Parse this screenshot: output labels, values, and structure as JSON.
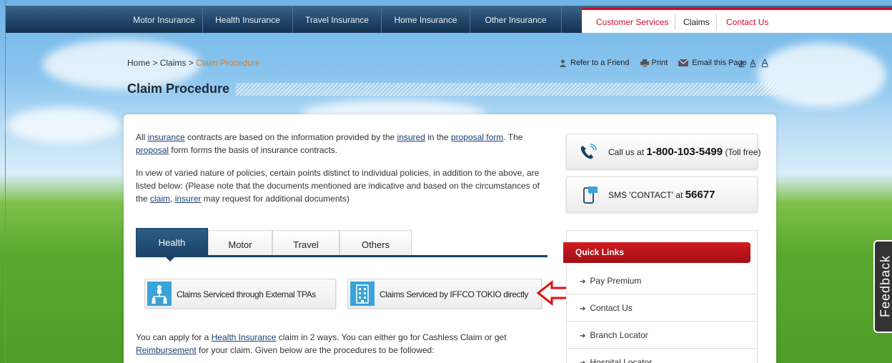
{
  "topnav": {
    "items": [
      "Motor Insurance",
      "Health Insurance",
      "Travel Insurance",
      "Home Insurance",
      "Other Insurance"
    ],
    "customer_services": "Customer Services",
    "claims": "Claims",
    "contact_us": "Contact Us"
  },
  "breadcrumb": {
    "home": "Home",
    "sep": " > ",
    "claims": "Claims",
    "current": "Claim Procedure"
  },
  "page_title": "Claim Procedure",
  "tools": {
    "refer": "Refer to a Friend",
    "print": "Print",
    "email": "Email this Page",
    "font_sizes": [
      "A",
      "A",
      "A"
    ]
  },
  "intro": {
    "p1": {
      "all": "All ",
      "insurance": "insurance",
      "t1": " contracts are based on the information provided by the ",
      "insured": "insured",
      "t2": " in the ",
      "proposal_form": "proposal form",
      "t3": ". The ",
      "proposal": "proposal",
      "t4": " form forms the basis of insurance contracts."
    },
    "p2": {
      "t1": "In view of varied nature of policies, certain points distinct to individual policies, in addition to the above, are listed below: (Please note that the documents mentioned are indicative and based on the circumstances of the ",
      "claim": "claim",
      "t2": ", ",
      "insurer": "insurer",
      "t3": " may request for additional documents)"
    }
  },
  "tabs": [
    "Health",
    "Motor",
    "Travel",
    "Others"
  ],
  "claim_options": {
    "tpa": "Claims Serviced through External TPAs",
    "direct": "Claims Serviced by IFFCO TOKIO directly"
  },
  "bottom_text": {
    "t1": "You can apply for a ",
    "health_insurance": "Health Insurance",
    "t2": " claim in 2 ways. You can either go for Cashless Claim or get ",
    "reimbursement": "Reimbursement",
    "t3": " for your claim. Given below are the procedures to be followed:"
  },
  "call": {
    "prefix": "Call us at ",
    "number": "1-800-103-5499",
    "suffix": " (Toll free)"
  },
  "sms": {
    "prefix": "SMS 'CONTACT' at ",
    "number": "56677"
  },
  "quick_links": {
    "title": "Quick Links",
    "items": [
      "Pay Premium",
      "Contact Us",
      "Branch Locator",
      "Hospital Locator"
    ]
  },
  "feedback": "Feedback",
  "colors": {
    "nav_blue": "#22466a",
    "accent_red": "#c8102e",
    "icon_blue": "#3aa3d9",
    "link_blue": "#1a3f73"
  }
}
